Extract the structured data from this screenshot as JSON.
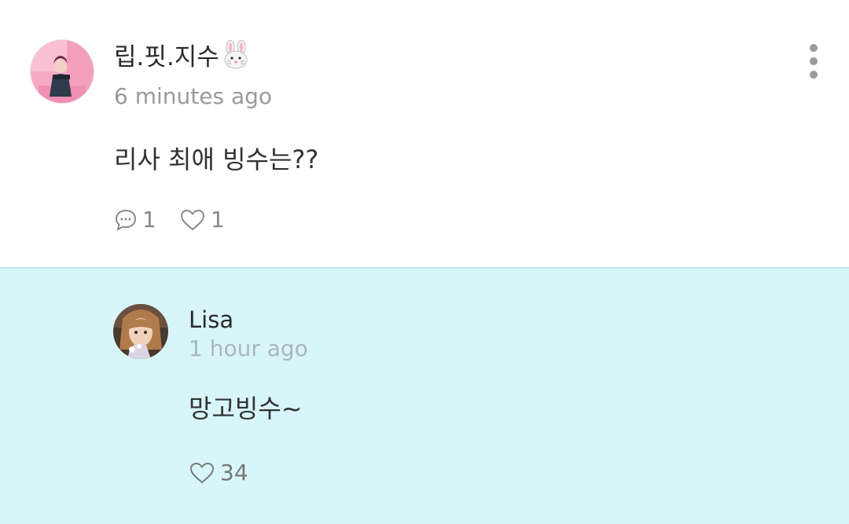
{
  "comment": {
    "username": "립.핏.지수",
    "username_emoji": "rabbit-face-icon",
    "timestamp": "6 minutes ago",
    "body": "리사 최애 빙수는??",
    "reply_count": "1",
    "like_count": "1",
    "more_icon": "more-vertical-icon"
  },
  "reply": {
    "username": "Lisa",
    "timestamp": "1 hour ago",
    "body": "망고빙수~",
    "like_count": "34"
  },
  "colors": {
    "reply_background": "#d8f6fa",
    "text_primary": "#2a2a2a",
    "text_secondary": "#9a9a9a"
  }
}
